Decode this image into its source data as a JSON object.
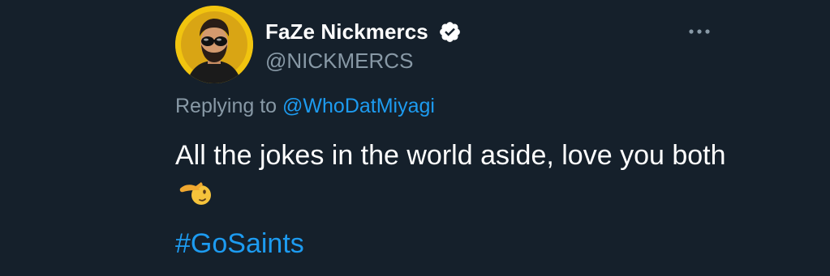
{
  "tweet": {
    "author": {
      "display_name": "FaZe Nickmercs",
      "handle": "@NICKMERCS",
      "verified_icon": "verified-badge-icon",
      "avatar": "avatar-image"
    },
    "more_icon": "more-options-icon",
    "reply": {
      "prefix": "Replying to",
      "mention": "@WhoDatMiyagi"
    },
    "text": "All the jokes in the world aside, love you both",
    "emoji": "salute-emoji-icon",
    "hashtag": "#GoSaints"
  },
  "colors": {
    "background": "#15202b",
    "text_primary": "#ffffff",
    "text_secondary": "#8899a6",
    "accent": "#1d9bf0",
    "avatar_ring": "#f1c40f"
  }
}
